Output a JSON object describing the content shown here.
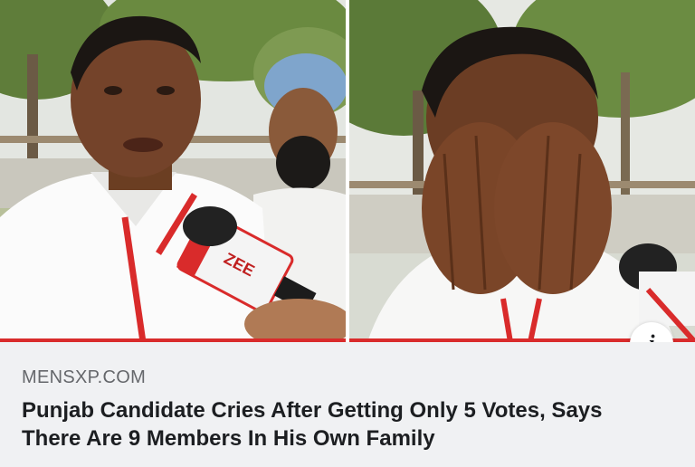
{
  "post": {
    "source_domain": "MENSXP.COM",
    "headline": "Punjab Candidate Cries After Getting Only 5 Votes, Says There Are 9 Members In His Own Family",
    "info_glyph": "i",
    "info_icon": "info-icon"
  },
  "image": {
    "mic_flag_text": "ZEE"
  },
  "colors": {
    "caption_bg": "#f0f1f3",
    "headline_text": "#1c1e21",
    "source_text": "#65676b",
    "lanyard": "#d92b2b"
  }
}
